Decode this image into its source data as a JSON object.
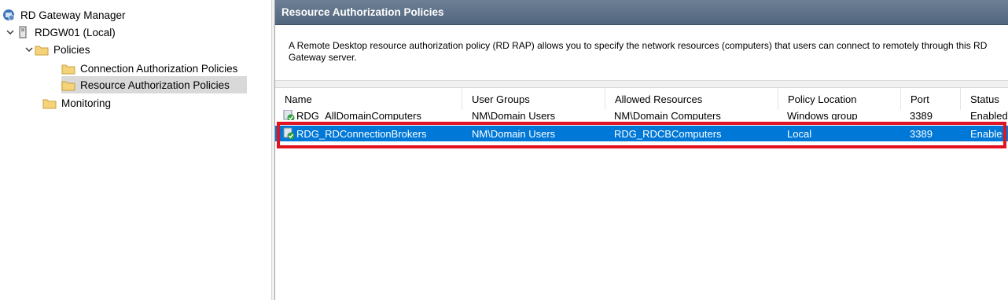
{
  "tree": {
    "root": "RD Gateway Manager",
    "server": "RDGW01 (Local)",
    "policies": "Policies",
    "cap": "Connection Authorization Policies",
    "rap": "Resource Authorization Policies",
    "monitoring": "Monitoring"
  },
  "panel": {
    "title": "Resource Authorization Policies",
    "description": "A Remote Desktop resource authorization policy (RD RAP) allows you to specify the network resources (computers) that users can connect to remotely through this RD Gateway server."
  },
  "table": {
    "columns": [
      "Name",
      "User Groups",
      "Allowed Resources",
      "Policy Location",
      "Port",
      "Status"
    ],
    "rows": [
      [
        "RDG_AllDomainComputers",
        "NM\\Domain Users",
        "NM\\Domain Computers",
        "Windows group",
        "3389",
        "Enabled"
      ],
      [
        "RDG_RDConnectionBrokers",
        "NM\\Domain Users",
        "RDG_RDCBComputers",
        "Local",
        "3389",
        "Enable"
      ]
    ]
  },
  "colors": {
    "selection": "#0078d7",
    "header": "#5a6e85",
    "highlight_box": "#e11320",
    "folder": "#f5d37a"
  }
}
